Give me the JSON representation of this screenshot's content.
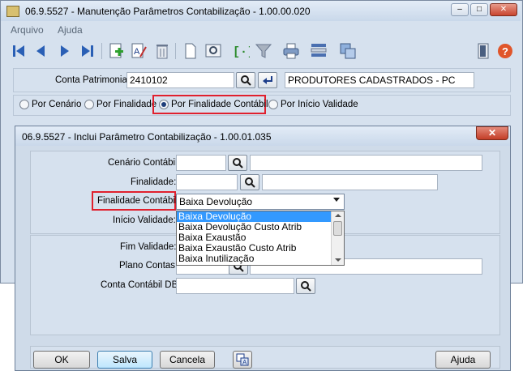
{
  "app": {
    "title": "06.9.5527 - Manutenção Parâmetros Contabilização - 1.00.00.020",
    "window_controls": {
      "minimize": "–",
      "maximize": "□",
      "close": "✕"
    }
  },
  "menu": {
    "items": [
      "Arquivo",
      "Ajuda"
    ]
  },
  "toolbar": {
    "buttons": [
      "first-icon",
      "prev-icon",
      "next-icon",
      "last-icon",
      "add-icon",
      "edit-icon",
      "delete-icon",
      "new-document-icon",
      "preview-icon",
      "goto-icon",
      "filter-icon",
      "print-icon",
      "list-icon",
      "copy-icon",
      "exit-icon",
      "help-icon"
    ]
  },
  "conta": {
    "label": "Conta Patrimonial:",
    "value": "2410102",
    "description": "PRODUTORES CADASTRADOS - PC"
  },
  "filter_options": [
    {
      "label": "Por Cenário",
      "selected": false
    },
    {
      "label": "Por Finalidade",
      "selected": false
    },
    {
      "label": "Por Finalidade Contábil",
      "selected": true
    },
    {
      "label": "Por Início Validade",
      "selected": false
    }
  ],
  "dialog": {
    "title": "06.9.5527 - Inclui Parâmetro Contabilização - 1.00.01.035",
    "close": "✕",
    "fields": {
      "cenario_label": "Cenário Contábil:",
      "finalidade_label": "Finalidade:",
      "finalidade_contabil_label": "Finalidade Contábil:",
      "finalidade_contabil_value": "Baixa Devolução",
      "inicio_label": "Início Validade:",
      "fim_label": "Fim Validade:",
      "plano_label": "Plano Contas:",
      "conta_db_label": "Conta Contábil DB:"
    },
    "dropdown_options": [
      "Baixa Devolução",
      "Baixa Devolução Custo Atrib",
      "Baixa Exaustão",
      "Baixa Exaustão Custo Atrib",
      "Baixa Inutilização"
    ],
    "selected_option_index": 0,
    "buttons": {
      "ok": "OK",
      "save": "Salva",
      "cancel": "Cancela",
      "help": "Ajuda"
    }
  }
}
